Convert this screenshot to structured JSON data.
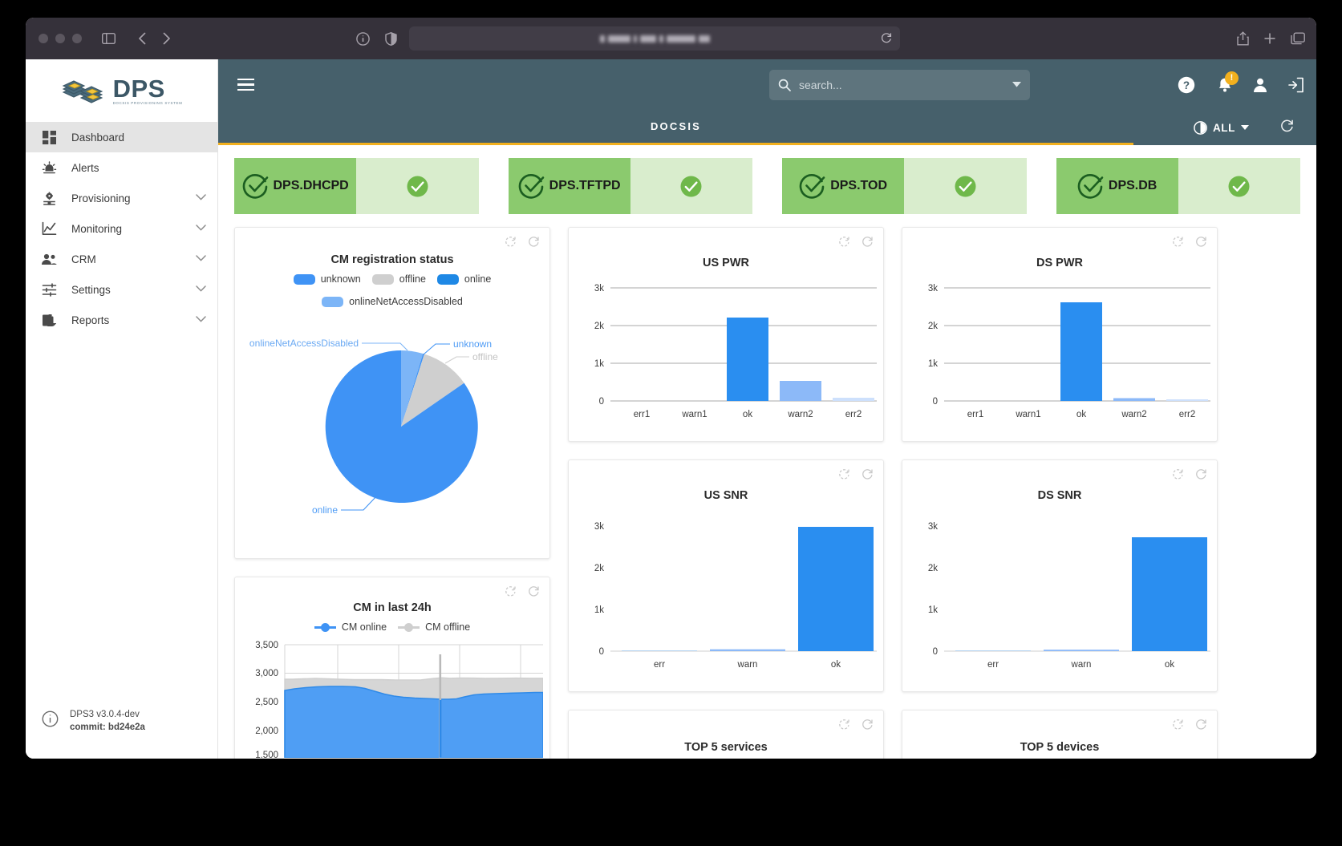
{
  "browser": {
    "url_masked": true,
    "reload_icon": "reload-icon",
    "back_icon": "back-arrow-icon",
    "forward_icon": "forward-arrow-icon",
    "sidebar_icon": "sidebar-toggle-icon",
    "shield_icon": "shield-icon",
    "info_icon": "info-icon",
    "share_icon": "share-icon",
    "newtab_icon": "plus-icon",
    "tabs_icon": "tabs-icon"
  },
  "sidebar": {
    "logo_text": "DPS",
    "logo_subtitle": "DOCSIS PROVISIONING SYSTEM",
    "items": [
      {
        "label": "Dashboard",
        "icon": "dashboard-icon",
        "active": true,
        "expandable": false
      },
      {
        "label": "Alerts",
        "icon": "alert-bell-icon",
        "active": false,
        "expandable": false
      },
      {
        "label": "Provisioning",
        "icon": "gear-slider-icon",
        "active": false,
        "expandable": true
      },
      {
        "label": "Monitoring",
        "icon": "line-chart-icon",
        "active": false,
        "expandable": true
      },
      {
        "label": "CRM",
        "icon": "people-icon",
        "active": false,
        "expandable": true
      },
      {
        "label": "Settings",
        "icon": "sliders-icon",
        "active": false,
        "expandable": true
      },
      {
        "label": "Reports",
        "icon": "clipboard-icon",
        "active": false,
        "expandable": true
      }
    ],
    "version": "DPS3 v3.0.4-dev",
    "commit": "commit: bd24e2a",
    "info_icon": "info-circle-icon"
  },
  "topbar": {
    "menu_icon": "hamburger-menu-icon",
    "search_placeholder": "search...",
    "search_value": "",
    "search_icon": "search-icon",
    "search_dropdown_icon": "chevron-down-icon",
    "help_icon": "help-question-icon",
    "notifications_icon": "bell-icon",
    "notifications_badge": "!",
    "account_icon": "person-icon",
    "logout_icon": "logout-icon",
    "more_icon": "hamburger-menu-icon",
    "badge_color": "#f2b01e"
  },
  "subbar": {
    "tab_label": "DOCSIS",
    "scope_label": "ALL",
    "scope_icon": "contrast-circle-icon",
    "scope_caret_icon": "caret-down-icon",
    "refresh_icon": "refresh-icon",
    "accent_color": "#f2b01e"
  },
  "services": [
    {
      "name": "DPS.DHCPD",
      "status": "ok",
      "check_icon": "check-circle-icon",
      "status_icon": "check-filled-icon"
    },
    {
      "name": "DPS.TFTPD",
      "status": "ok",
      "check_icon": "check-circle-icon",
      "status_icon": "check-filled-icon"
    },
    {
      "name": "DPS.TOD",
      "status": "ok",
      "check_icon": "check-circle-icon",
      "status_icon": "check-filled-icon"
    },
    {
      "name": "DPS.DB",
      "status": "ok",
      "check_icon": "check-circle-icon",
      "status_icon": "check-filled-icon"
    }
  ],
  "panel_tools": {
    "auto_refresh_icon": "auto-refresh-icon",
    "refresh_icon": "refresh-icon"
  },
  "panels": {
    "cm_registration": {
      "title": "CM registration status"
    },
    "us_pwr": {
      "title": "US PWR"
    },
    "ds_pwr": {
      "title": "DS PWR"
    },
    "us_snr": {
      "title": "US SNR"
    },
    "ds_snr": {
      "title": "DS SNR"
    },
    "cm_24h": {
      "title": "CM in last 24h"
    },
    "top5_services": {
      "title": "TOP 5 services"
    },
    "top5_devices": {
      "title": "TOP 5 devices"
    }
  },
  "chart_data": [
    {
      "id": "cm_registration",
      "type": "pie",
      "title": "CM registration status",
      "legend_position": "top",
      "labels": [
        "unknown",
        "offline",
        "online",
        "onlineNetAccessDisabled"
      ],
      "colors": [
        "#3f93f5",
        "#cfcfcf",
        "#1e88e5",
        "#7cb5f7"
      ],
      "values": [
        10,
        232,
        2520,
        135
      ],
      "percentages": [
        0.3,
        8.0,
        87.1,
        4.6
      ],
      "annotations": [
        "onlineNetAccessDisabled",
        "unknown",
        "offline",
        "online"
      ]
    },
    {
      "id": "us_pwr",
      "type": "bar",
      "title": "US PWR",
      "categories": [
        "err1",
        "warn1",
        "ok",
        "warn2",
        "err2"
      ],
      "values": [
        0,
        0,
        2210,
        540,
        80
      ],
      "colors": [
        "#2a8ef0",
        "#2a8ef0",
        "#2a8ef0",
        "#8cb9f8",
        "#cde0fc"
      ],
      "ylim": [
        0,
        3200
      ],
      "yticks": [
        0,
        1000,
        2000,
        3000
      ],
      "yticklabels": [
        "0",
        "1k",
        "2k",
        "3k"
      ],
      "xlabel": "",
      "ylabel": "",
      "grid": true
    },
    {
      "id": "ds_pwr",
      "type": "bar",
      "title": "DS PWR",
      "categories": [
        "err1",
        "warn1",
        "ok",
        "warn2",
        "err2"
      ],
      "values": [
        0,
        0,
        2620,
        75,
        40
      ],
      "colors": [
        "#2a8ef0",
        "#2a8ef0",
        "#2a8ef0",
        "#8cb9f8",
        "#cde0fc"
      ],
      "ylim": [
        0,
        3200
      ],
      "yticks": [
        0,
        1000,
        2000,
        3000
      ],
      "yticklabels": [
        "0",
        "1k",
        "2k",
        "3k"
      ],
      "xlabel": "",
      "ylabel": "",
      "grid": true
    },
    {
      "id": "us_snr",
      "type": "bar",
      "title": "US SNR",
      "categories": [
        "err",
        "warn",
        "ok"
      ],
      "values": [
        5,
        45,
        2970
      ],
      "colors": [
        "#2a8ef0",
        "#8cb9f8",
        "#2a8ef0"
      ],
      "ylim": [
        0,
        3250
      ],
      "yticks": [
        0,
        1000,
        2000,
        3000
      ],
      "yticklabels": [
        "0",
        "1k",
        "2k",
        "3k"
      ],
      "xlabel": "",
      "ylabel": "",
      "grid": false
    },
    {
      "id": "ds_snr",
      "type": "bar",
      "title": "DS SNR",
      "categories": [
        "err",
        "warn",
        "ok"
      ],
      "values": [
        5,
        35,
        2720
      ],
      "colors": [
        "#2a8ef0",
        "#8cb9f8",
        "#2a8ef0"
      ],
      "ylim": [
        0,
        3250
      ],
      "yticks": [
        0,
        1000,
        2000,
        3000
      ],
      "yticklabels": [
        "0",
        "1k",
        "2k",
        "3k"
      ],
      "xlabel": "",
      "ylabel": "",
      "grid": false
    },
    {
      "id": "cm_24h",
      "type": "area",
      "title": "CM in last 24h",
      "legend_position": "top",
      "series": [
        {
          "name": "CM online",
          "color": "#3f93f5"
        },
        {
          "name": "CM offline",
          "color": "#cfcfcf"
        }
      ],
      "yticks": [
        1500,
        2000,
        2500,
        3000,
        3500
      ],
      "yticklabels": [
        "1,500",
        "2,000",
        "2,500",
        "3,000",
        "3,500"
      ],
      "ylim": [
        1500,
        3500
      ],
      "grid": true,
      "online_approx": [
        2700,
        2730,
        2760,
        2780,
        2790,
        2790,
        2780,
        2700,
        2620,
        2600,
        2590,
        2580,
        2590,
        2650,
        2700,
        2730,
        2740
      ],
      "offline_approx": [
        2900,
        2900,
        2905,
        2905,
        2900,
        2895,
        2895,
        2895,
        2890,
        2890,
        2900,
        2920,
        2915,
        2910,
        2905,
        2905,
        2905
      ],
      "spike_note": "brief drop spike near mid-range"
    }
  ]
}
